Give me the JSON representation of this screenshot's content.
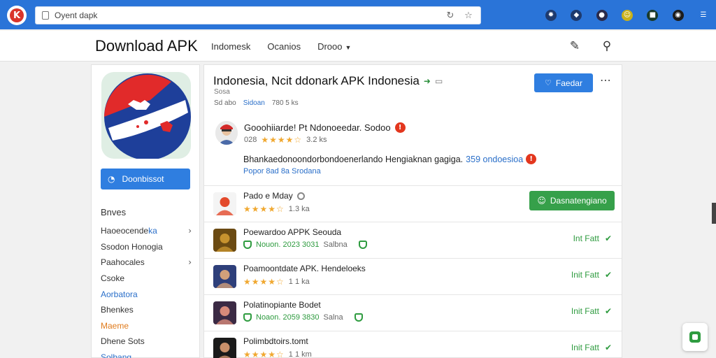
{
  "browser": {
    "url": "Oyent dapk",
    "reload_icon": "reload-icon",
    "bookmark_icon": "star-icon",
    "extensions": [
      {
        "name": "gear-ext-icon",
        "glyph": "✹",
        "color": "#1e3a6e"
      },
      {
        "name": "shield-ext-icon",
        "glyph": "◆",
        "color": "#1e3a6e"
      },
      {
        "name": "profile-ext-icon",
        "glyph": "●",
        "color": "#2a2a4a"
      },
      {
        "name": "smile-ext-icon",
        "glyph": "☺",
        "color": "#c9b21a"
      },
      {
        "name": "robot-ext-icon",
        "glyph": "■",
        "color": "#1a3a2a"
      },
      {
        "name": "camera-ext-icon",
        "glyph": "◉",
        "color": "#1c1c1c"
      },
      {
        "name": "menu-icon",
        "glyph": "☰",
        "color": "#2a74d8"
      }
    ]
  },
  "header": {
    "title": "Download APK",
    "nav": [
      "Indomesk",
      "Ocanios",
      "Drooo"
    ],
    "edit_icon": "edit-icon",
    "user_icon": "user-icon"
  },
  "sidebar": {
    "button_label": "Doonbissot",
    "heading": "Bnves",
    "items": [
      {
        "label": "Haoeocende",
        "accent": "ka",
        "chevron": true,
        "color": "#333333"
      },
      {
        "label": "Ssodon Honogia",
        "chevron": false,
        "color": "#333333"
      },
      {
        "label": "Paahocales",
        "chevron": true,
        "color": "#333333"
      },
      {
        "label": "Csoke",
        "chevron": false,
        "color": "#333333"
      },
      {
        "label": "Aorbatora",
        "chevron": false,
        "color": "#2a6fc9"
      },
      {
        "label": "Bhenkes",
        "chevron": false,
        "color": "#333333"
      },
      {
        "label": "Maeme",
        "chevron": false,
        "color": "#e07b1c"
      },
      {
        "label": "Dhene Sots",
        "chevron": false,
        "color": "#333333"
      },
      {
        "label": "Solbang",
        "chevron": false,
        "color": "#2a6fc9"
      }
    ]
  },
  "app": {
    "title": "Indonesia, Ncit ddonark APK Indonesia",
    "subtitle": "Sosa",
    "meta": [
      "Sd abo",
      "Sidoan",
      "780 5 ks"
    ],
    "follow_label": "Faedar",
    "developer": {
      "name": "Gooohiiarde! Pt Ndonoeedar. Sodoo",
      "rating_num": "028",
      "stars": "★★★★",
      "half": "☆",
      "reviews": "3.2 ks"
    },
    "description": "Bhankaedonoondorbondoenerlando Hengiaknan gagiga.",
    "description_link": "359 ondoesioa",
    "description_links": "Popor 8ad 8a Srodana"
  },
  "apps_list": [
    {
      "name": "Pado e Mday",
      "stars": "★★★★",
      "half": "☆",
      "meta": "1.3 ka",
      "action": "Dasnatengiano",
      "variant": "install",
      "icon_color": "#f4f4f4",
      "icon_accent": "#e34a2c"
    },
    {
      "name": "Poewardoo APPK Seouda",
      "meta_green": "Nouon. 2023 3031",
      "meta": "Salbna",
      "action": "Int Fatt",
      "variant": "verified",
      "icon_color": "#6b4a12",
      "icon_accent": "#c7922e"
    },
    {
      "name": "Poamoontdate APK. Hendeloeks",
      "stars": "★★★★",
      "half": "☆",
      "meta": "1 1 ka",
      "action": "Init Fatt",
      "variant": "stars",
      "icon_color": "#2e3f7a",
      "icon_accent": "#d2a07a"
    },
    {
      "name": "Polatinopiante Bodet",
      "meta_green": "Noaon. 2059 3830",
      "meta": "Salna",
      "action": "Init Fatt",
      "variant": "verified",
      "icon_color": "#3b2a44",
      "icon_accent": "#d88a7a"
    },
    {
      "name": "Polimbdtoirs.tomt",
      "stars": "★★★★",
      "half": "☆",
      "meta": "1 1 km",
      "action": "Init Fatt",
      "variant": "stars",
      "icon_color": "#1a1a1a",
      "icon_accent": "#c9906a"
    }
  ]
}
